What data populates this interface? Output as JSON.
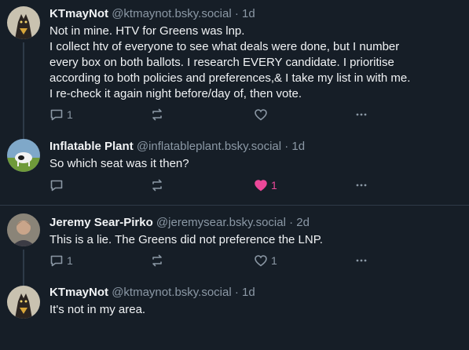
{
  "posts": [
    {
      "display_name": "KTmayNot",
      "handle": "@ktmaynot.bsky.social",
      "time": "1d",
      "lines": [
        "Not in mine. HTV for Greens was lnp.",
        "I collect htv of everyone to see what deals were done, but I number",
        "every box on both ballots. I research EVERY candidate. I prioritise",
        "according to both policies and preferences,& I take my list in with me.",
        "I re-check it again night before/day of, then vote."
      ],
      "reply_count": "1",
      "repost_count": "",
      "like_count": "",
      "liked": false
    },
    {
      "display_name": "Inflatable Plant",
      "handle": "@inflatableplant.bsky.social",
      "time": "1d",
      "lines": [
        "So which seat was it then?"
      ],
      "reply_count": "",
      "repost_count": "",
      "like_count": "1",
      "liked": true
    },
    {
      "display_name": "Jeremy Sear-Pirko",
      "handle": "@jeremysear.bsky.social",
      "time": "2d",
      "lines": [
        "This is a lie. The Greens did not preference the LNP."
      ],
      "reply_count": "1",
      "repost_count": "",
      "like_count": "1",
      "liked": false
    },
    {
      "display_name": "KTmayNot",
      "handle": "@ktmaynot.bsky.social",
      "time": "1d",
      "lines": [
        "It's not in my area."
      ],
      "reply_count": "",
      "repost_count": "",
      "like_count": "",
      "liked": false
    }
  ],
  "separator": "·",
  "colors": {
    "background": "#161e27",
    "text": "#f1f3f5",
    "muted": "#8b98a5",
    "like": "#ec4899",
    "line": "#2e3a48"
  },
  "icons": [
    "reply-icon",
    "repost-icon",
    "like-icon",
    "more-icon"
  ]
}
